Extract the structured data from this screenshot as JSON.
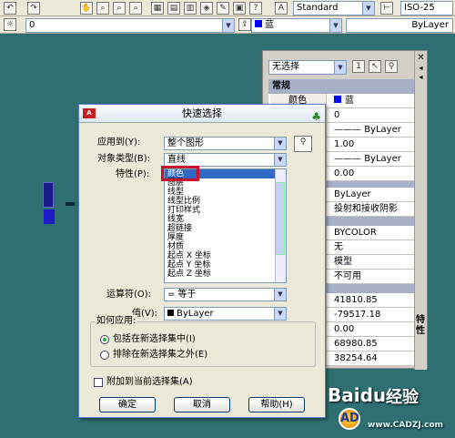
{
  "toolbar": {
    "textstyle": "Standard",
    "dimstyle": "ISO-25",
    "layer": "0",
    "color": "蓝",
    "linetype": "ByLayer"
  },
  "palette": {
    "selection": "无选择",
    "section_general": "常规",
    "rows": [
      {
        "k": "颜色",
        "v": "蓝"
      },
      {
        "k": "",
        "v": "0"
      },
      {
        "k": "",
        "v": "ByLayer"
      },
      {
        "k": "",
        "v": "1.00"
      },
      {
        "k": "",
        "v": "ByLayer"
      },
      {
        "k": "",
        "v": "0.00"
      }
    ],
    "rows2": [
      "ByLayer",
      "投射和接收阴影"
    ],
    "rows3": [
      "BYCOLOR",
      "无",
      "模型",
      "不可用"
    ],
    "rows4": [
      "41810.85",
      "-79517.18",
      "0.00",
      "68980.85",
      "38254.64"
    ],
    "side_label": "特性"
  },
  "dialog": {
    "title": "快速选择",
    "apply_label": "应用到(Y):",
    "apply_value": "整个图形",
    "objtype_label": "对象类型(B):",
    "objtype_value": "直线",
    "props_label": "特性(P):",
    "props": [
      "颜色",
      "图层",
      "线型",
      "线型比例",
      "打印样式",
      "线宽",
      "超链接",
      "厚度",
      "材质",
      "起点 X 坐标",
      "起点 Y 坐标",
      "起点 Z 坐标"
    ],
    "operator_label": "运算符(O):",
    "operator_value": "= 等于",
    "value_label": "值(V):",
    "value_value": "ByLayer",
    "howapply": "如何应用:",
    "radio_include": "包括在新选择集中(I)",
    "radio_exclude": "排除在新选择集之外(E)",
    "append": "附加到当前选择集(A)",
    "ok": "确定",
    "cancel": "取消",
    "help": "帮助(H)"
  },
  "watermark": {
    "baidu": "Baidu",
    "jingyan": "经验",
    "site": "www.CADZJ.com"
  }
}
